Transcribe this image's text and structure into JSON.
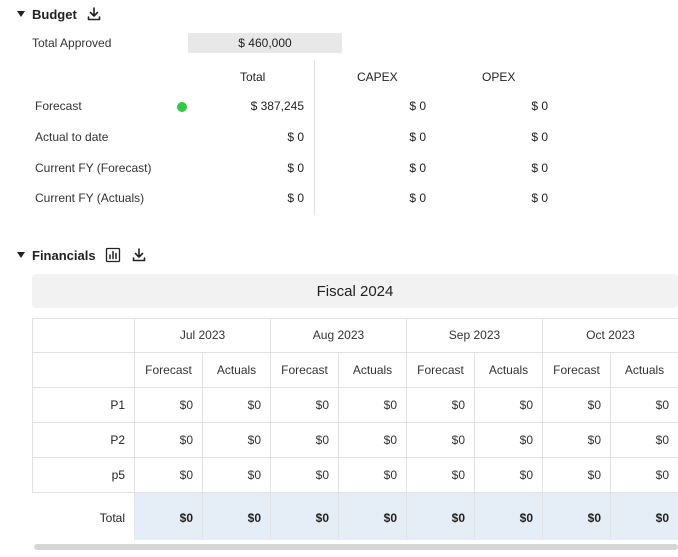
{
  "budget": {
    "title": "Budget",
    "approved_label": "Total Approved",
    "approved_value": "$ 460,000",
    "columns": [
      "Total",
      "CAPEX",
      "OPEX"
    ],
    "rows": [
      {
        "label": "Forecast",
        "total": "$ 387,245",
        "capex": "$ 0",
        "opex": "$ 0"
      },
      {
        "label": "Actual to date",
        "total": "$ 0",
        "capex": "$ 0",
        "opex": "$ 0"
      },
      {
        "label": "Current FY (Forecast)",
        "total": "$ 0",
        "capex": "$ 0",
        "opex": "$ 0"
      },
      {
        "label": "Current FY (Actuals)",
        "total": "$ 0",
        "capex": "$ 0",
        "opex": "$ 0"
      }
    ],
    "status_color": "#2ecc40"
  },
  "financials": {
    "title": "Financials",
    "fiscal_label": "Fiscal 2024",
    "months": [
      "Jul 2023",
      "Aug 2023",
      "Sep 2023",
      "Oct 2023"
    ],
    "subheaders": [
      "Forecast",
      "Actuals"
    ],
    "rows": [
      {
        "label": "P1",
        "values": [
          "$0",
          "$0",
          "$0",
          "$0",
          "$0",
          "$0",
          "$0",
          "$0"
        ]
      },
      {
        "label": "P2",
        "values": [
          "$0",
          "$0",
          "$0",
          "$0",
          "$0",
          "$0",
          "$0",
          "$0"
        ]
      },
      {
        "label": "p5",
        "values": [
          "$0",
          "$0",
          "$0",
          "$0",
          "$0",
          "$0",
          "$0",
          "$0"
        ]
      }
    ],
    "total": {
      "label": "Total",
      "values": [
        "$0",
        "$0",
        "$0",
        "$0",
        "$0",
        "$0",
        "$0",
        "$0"
      ]
    },
    "total_row_color": "#e5eef6"
  },
  "icons": {
    "budget_download": "download-icon",
    "fin_chart": "bar-chart-icon",
    "fin_download": "download-icon"
  }
}
